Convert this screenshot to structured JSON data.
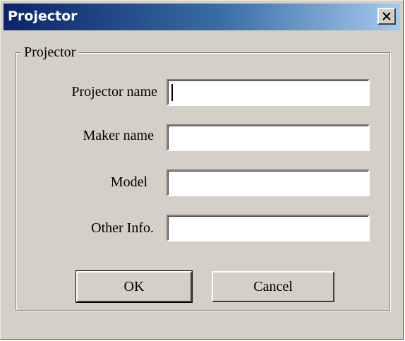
{
  "window": {
    "title": "Projector",
    "close_icon": "close-icon"
  },
  "group": {
    "label": "Projector"
  },
  "fields": {
    "projector_name": {
      "label": "Projector name",
      "value": ""
    },
    "maker_name": {
      "label": "Maker name",
      "value": ""
    },
    "model": {
      "label": "Model",
      "value": ""
    },
    "other_info": {
      "label": "Other Info.",
      "value": ""
    }
  },
  "buttons": {
    "ok": "OK",
    "cancel": "Cancel"
  },
  "colors": {
    "title_start": "#0a246a",
    "title_end": "#a6caf0",
    "dialog_bg": "#d4d0c8"
  }
}
